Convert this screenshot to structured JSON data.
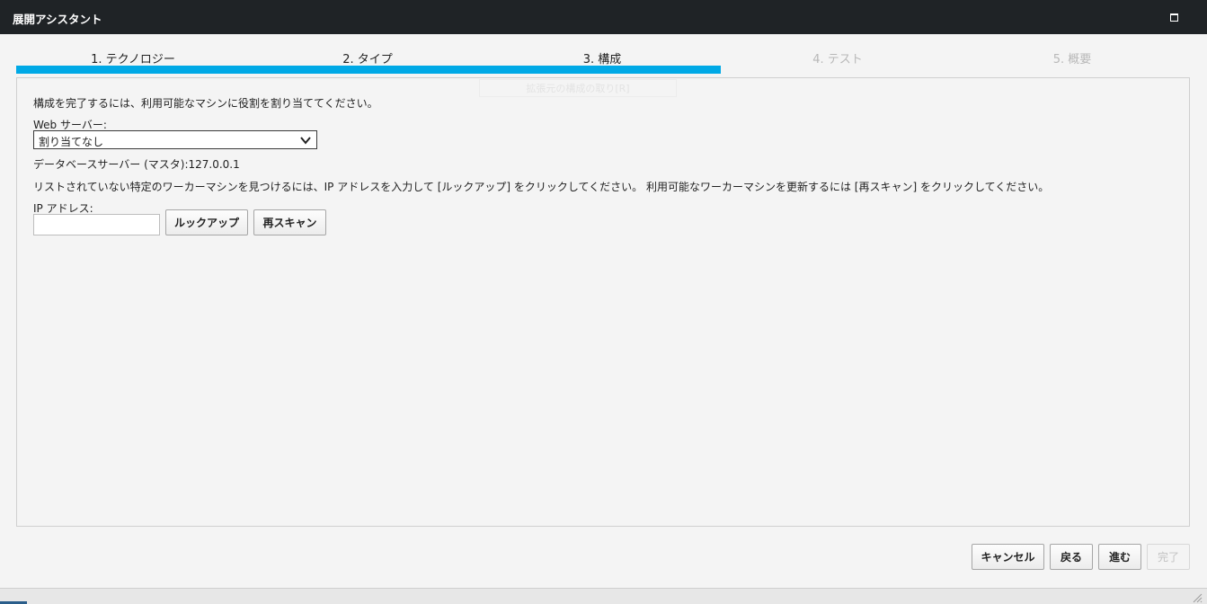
{
  "window": {
    "title": "展開アシスタント",
    "maximize_icon": "maximize-icon"
  },
  "steps": [
    {
      "label": "1. テクノロジー",
      "state": "done"
    },
    {
      "label": "2. タイプ",
      "state": "done"
    },
    {
      "label": "3. 構成",
      "state": "current"
    },
    {
      "label": "4. テスト",
      "state": "pending"
    },
    {
      "label": "5. 概要",
      "state": "pending"
    }
  ],
  "progress": {
    "completed_steps": 3,
    "total_steps": 5,
    "color": "#00a9e6"
  },
  "ghost_button_label": "拡張元の構成の取り[R]",
  "main": {
    "instruction": "構成を完了するには、利用可能なマシンに役割を割り当ててください。",
    "web_server_label": "Web サーバー:",
    "web_server_value": "割り当てなし",
    "database_server": "データベースサーバー (マスタ):127.0.0.1",
    "lookup_instruction": "リストされていない特定のワーカーマシンを見つけるには、IP アドレスを入力して [ルックアップ] をクリックしてください。 利用可能なワーカーマシンを更新するには [再スキャン] をクリックしてください。",
    "ip_label": "IP アドレス:",
    "ip_value": "",
    "lookup_button": "ルックアップ",
    "rescan_button": "再スキャン"
  },
  "footer": {
    "cancel": "キャンセル",
    "back": "戻る",
    "next": "進む",
    "finish": "完了"
  }
}
